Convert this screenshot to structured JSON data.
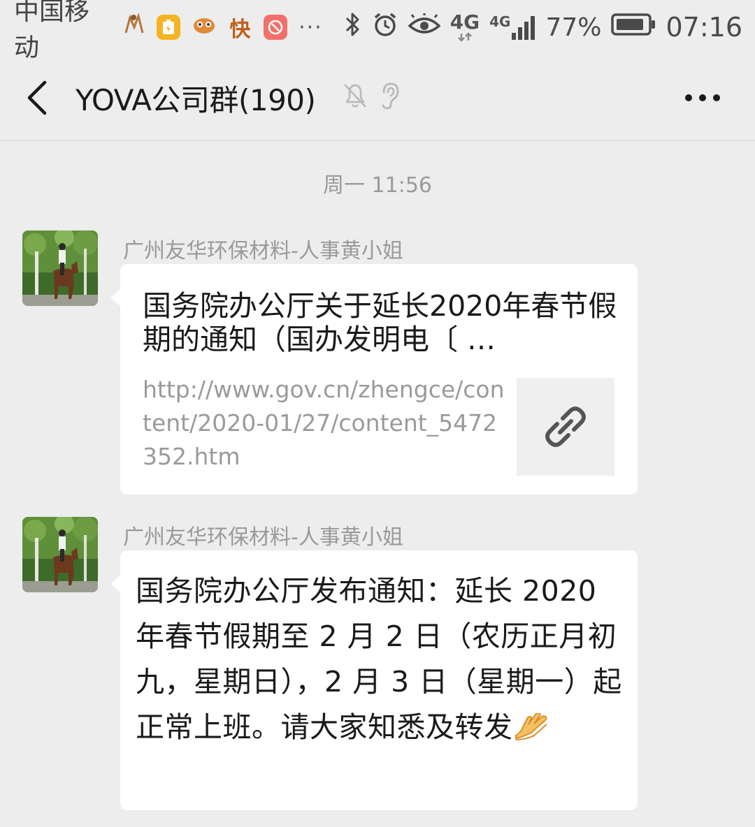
{
  "status_bar": {
    "carrier": "中国移动",
    "app_icon_kuai": "快",
    "more": "···",
    "network_1": "4G",
    "network_2": "4G",
    "battery": "77%",
    "time": "07:16"
  },
  "header": {
    "title": "YOVA公司群(190)"
  },
  "chat": {
    "time_divider": "周一 11:56",
    "messages": [
      {
        "sender": "广州友华环保材料-人事黄小姐",
        "type": "link",
        "title": "国务院办公厅关于延长2020年春节假期的通知（国办发明电〔 …",
        "url": "http://www.gov.cn/zhengce/content/2020-01/27/content_5472352.htm"
      },
      {
        "sender": "广州友华环保材料-人事黄小姐",
        "type": "text",
        "text": "国务院办公厅发布通知：延长 2020年春节假期至 2 月 2 日（农历正月初九，星期日），2 月 3 日（星期一）起正常上班。请大家知悉及转发"
      }
    ]
  },
  "icons": {
    "back": "back-arrow-icon",
    "mute": "mute-bell-icon",
    "ear": "earpiece-icon",
    "more": "more-dots-icon",
    "link": "link-chain-icon",
    "clap": "clap-emoji-icon"
  },
  "colors": {
    "background": "#ededed",
    "bubble": "#ffffff",
    "meta_text": "#9a9a9a"
  }
}
